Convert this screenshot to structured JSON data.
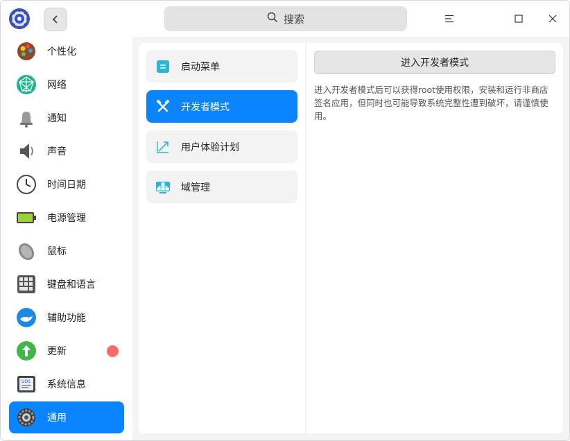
{
  "search": {
    "label": "搜索",
    "icon": "search-icon"
  },
  "window_controls": {
    "menu": "menu-icon",
    "maximize": "maximize-icon",
    "close": "close-icon"
  },
  "sidebar": {
    "items": [
      {
        "label": "个性化",
        "icon": "personalization-icon"
      },
      {
        "label": "网络",
        "icon": "network-icon"
      },
      {
        "label": "通知",
        "icon": "bell-icon"
      },
      {
        "label": "声音",
        "icon": "speaker-icon"
      },
      {
        "label": "时间日期",
        "icon": "clock-icon"
      },
      {
        "label": "电源管理",
        "icon": "battery-icon"
      },
      {
        "label": "鼠标",
        "icon": "mouse-icon"
      },
      {
        "label": "键盘和语言",
        "icon": "keyboard-icon"
      },
      {
        "label": "辅助功能",
        "icon": "accessibility-icon"
      },
      {
        "label": "更新",
        "icon": "update-icon",
        "badge": true
      },
      {
        "label": "系统信息",
        "icon": "system-info-icon"
      },
      {
        "label": "通用",
        "icon": "gear-icon",
        "active": true
      }
    ]
  },
  "general": {
    "items": [
      {
        "label": "启动菜单",
        "icon": "boot-menu-icon"
      },
      {
        "label": "开发者模式",
        "icon": "developer-tools-icon",
        "active": true
      },
      {
        "label": "用户体验计划",
        "icon": "trend-icon"
      },
      {
        "label": "域管理",
        "icon": "domain-icon"
      }
    ]
  },
  "developer": {
    "button_label": "进入开发者模式",
    "description": "进入开发者模式后可以获得root使用权限，安装和运行非商店签名应用，但同时也可能导致系统完整性遭到破坏，请谨慎使用。"
  },
  "colors": {
    "accent": "#0a84ff",
    "badge": "#ff6b6b"
  }
}
